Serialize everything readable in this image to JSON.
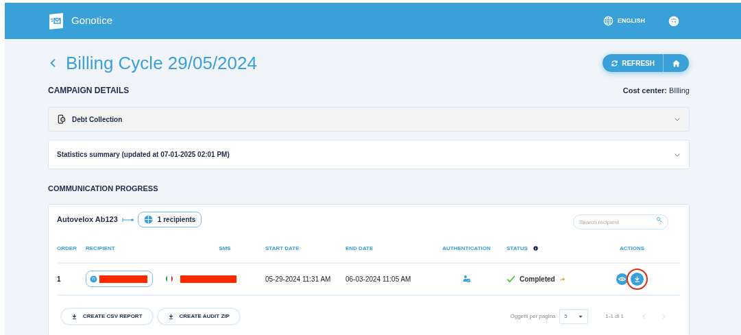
{
  "header": {
    "app_name": "Gonotice",
    "language": "ENGLISH"
  },
  "page": {
    "title": "Billing Cycle 29/05/2024",
    "refresh_label": "REFRESH"
  },
  "campaign_details": {
    "heading": "CAMPAIGN DETAILS",
    "cost_center_label": "Cost center:",
    "cost_center_value": "BIlling"
  },
  "panels": [
    {
      "title": "Debt Collection",
      "kind": "campaign",
      "expanded": false
    },
    {
      "title": "Statistics summary (updated at 07-01-2025 02:01 PM)",
      "kind": "summary",
      "expanded": false
    }
  ],
  "progress": {
    "heading": "COMMUNICATION PROGRESS",
    "campaign": "Autovelox Ab123",
    "recipients_badge": "1 recipients",
    "search": {
      "placeholder": "Search recipient"
    }
  },
  "table": {
    "columns": [
      "ORDER",
      "RECIPIENT",
      "SMS",
      "START DATE",
      "END DATE",
      "AUTHENTICATION",
      "STATUS",
      "ACTIONS"
    ],
    "rows": [
      {
        "order": "1",
        "start_date": "05-29-2024 11:31 AM",
        "end_date": "06-03-2024 11:05 AM",
        "status": "Completed"
      }
    ]
  },
  "footer": {
    "buttons": [
      "CREATE CSV REPORT",
      "CREATE AUDIT ZIP"
    ],
    "per_page_label": "Oggetti per pagina",
    "per_page_value": "5",
    "range": "1-1 di 1"
  }
}
